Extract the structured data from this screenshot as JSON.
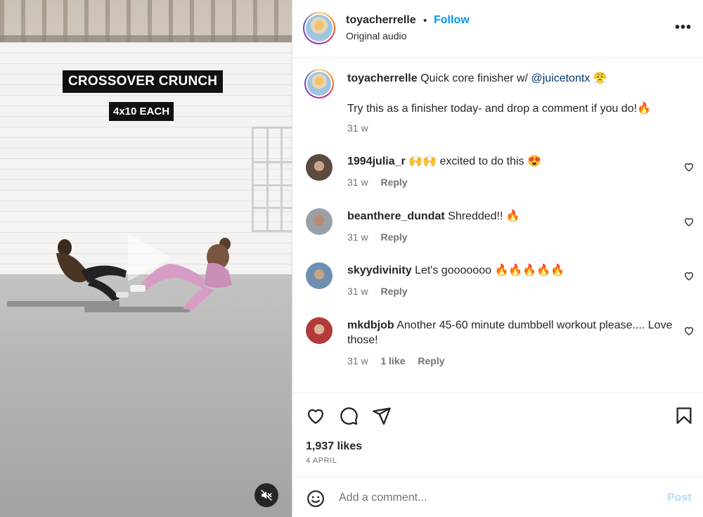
{
  "video": {
    "overlay_title": "CROSSOVER CRUNCH",
    "overlay_subtitle": "4x10 EACH"
  },
  "header": {
    "username": "toyacherrelle",
    "separator": "•",
    "follow_label": "Follow",
    "audio": "Original audio",
    "more_label": "•••"
  },
  "caption": {
    "username": "toyacherrelle",
    "text_before": "Quick core finisher w/",
    "mention": "@juicetontx",
    "emoji": "😤",
    "line2": "Try this as a finisher today- and drop a comment if you do!🔥",
    "time": "31 w"
  },
  "comments": [
    {
      "username": "1994julia_r",
      "text": "🙌🙌 excited to do this 😍",
      "time": "31 w",
      "likes": "",
      "reply": "Reply"
    },
    {
      "username": "beanthere_dundat",
      "text": "Shredded!! 🔥",
      "time": "31 w",
      "likes": "",
      "reply": "Reply"
    },
    {
      "username": "skyydivinity",
      "text": "Let's gooooooo 🔥🔥🔥🔥🔥",
      "time": "31 w",
      "likes": "",
      "reply": "Reply"
    },
    {
      "username": "mkdbjob",
      "text": "Another 45-60 minute dumbbell workout please.... Love those!",
      "time": "31 w",
      "likes": "1 like",
      "reply": "Reply"
    }
  ],
  "actions": {
    "likes": "1,937 likes",
    "date": "4 APRIL",
    "icons": [
      "heart-icon",
      "comment-icon",
      "share-icon",
      "bookmark-icon"
    ]
  },
  "add_comment": {
    "placeholder": "Add a comment...",
    "post_label": "Post"
  },
  "colors": {
    "link": "#0095f6",
    "mention": "#00376b",
    "muted": "#737373",
    "post_disabled": "#b3dbff"
  }
}
